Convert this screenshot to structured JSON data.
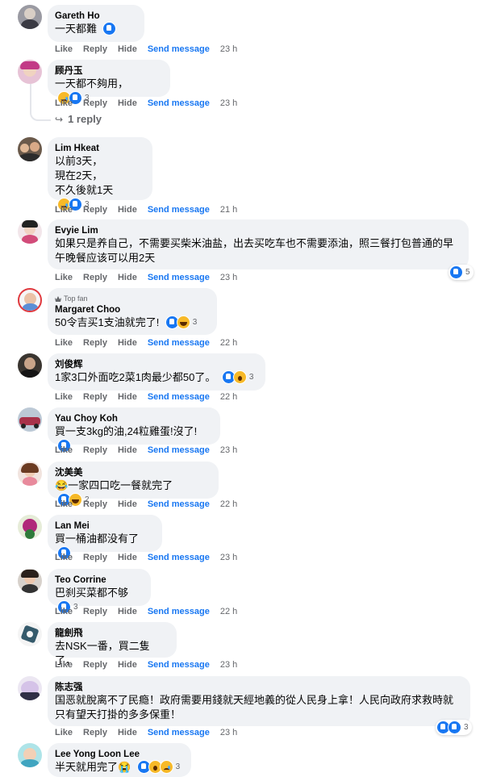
{
  "actions": {
    "like": "Like",
    "reply": "Reply",
    "hide": "Hide",
    "send": "Send message"
  },
  "reply_link": "1 reply",
  "top_fan_label": "Top fan",
  "comments": [
    {
      "author": "Gareth Ho",
      "text": "一天都難",
      "reactions": [
        "like"
      ],
      "count": "",
      "time": "23 h"
    },
    {
      "author": "顾丹玉",
      "text": "一天都不夠用，",
      "reactions": [
        "sad",
        "like"
      ],
      "count": "3",
      "time": "23 h"
    },
    {
      "author": "Lim Hkeat",
      "text": "以前3天，\n現在2天，\n不久後就1天",
      "reactions": [
        "sad",
        "like"
      ],
      "count": "3",
      "time": "21 h"
    },
    {
      "author": "Evyie Lim",
      "text": "如果只是养自己，不需要买柴米油盐，出去买吃车也不需要添油，照三餐打包普通的早午晚餐应该可以用2天",
      "reactions": [
        "like"
      ],
      "count": "5",
      "time": "23 h"
    },
    {
      "author": "Margaret Choo",
      "text": "50令吉买1支油就完了!",
      "reactions": [
        "like",
        "haha"
      ],
      "count": "3",
      "time": "22 h"
    },
    {
      "author": "刘俊辉",
      "text": "1家3口外面吃2菜1肉最少都50了。",
      "reactions": [
        "like",
        "wow"
      ],
      "count": "3",
      "time": "22 h"
    },
    {
      "author": "Yau Choy Koh",
      "text": "買一支3kg的油,24粒雞蛋!沒了!",
      "reactions": [
        "like"
      ],
      "count": "",
      "time": "23 h"
    },
    {
      "author": "沈美美",
      "text": "😂一家四口吃一餐就完了",
      "reactions": [
        "like",
        "haha"
      ],
      "count": "2",
      "time": "22 h"
    },
    {
      "author": "Lan Mei",
      "text": "買一桶油都没有了",
      "reactions": [
        "like"
      ],
      "count": "",
      "time": "23 h"
    },
    {
      "author": "Teo Corrine",
      "text": "巴刹买菜都不够",
      "reactions": [
        "like"
      ],
      "count": "3",
      "time": "22 h"
    },
    {
      "author": "龍劍飛",
      "text": "去NSK一番，買二隻了，",
      "reactions": [],
      "count": "",
      "time": "23 h"
    },
    {
      "author": "陈志强",
      "text": "国恶就脫离不了民瘾！政府需要用錢就天經地義的從人民身上拿！人民向政府求救時就只有望天打掛的多多保重！",
      "reactions": [
        "like"
      ],
      "count": "3",
      "time": "23 h"
    },
    {
      "author": "Lee Yong Loon Lee",
      "text": "半天就用完了😭",
      "reactions": [
        "like",
        "wow",
        "sad"
      ],
      "count": "3",
      "time": ""
    }
  ]
}
